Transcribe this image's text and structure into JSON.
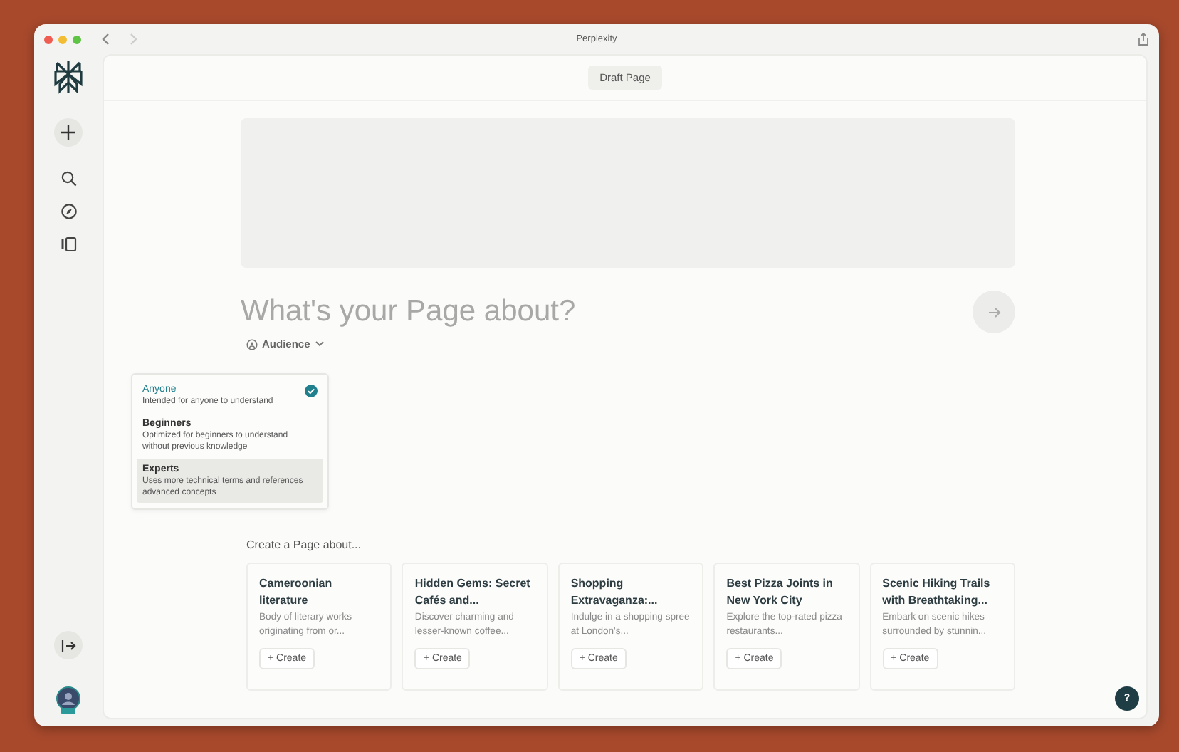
{
  "window": {
    "title": "Perplexity"
  },
  "header": {
    "button": "Draft Page"
  },
  "prompt": {
    "placeholder": "What's your Page about?"
  },
  "audience": {
    "label": "Audience",
    "options": [
      {
        "title": "Anyone",
        "description": "Intended for anyone to understand",
        "selected": true,
        "highlighted": false
      },
      {
        "title": "Beginners",
        "description": "Optimized for beginners to understand without previous knowledge",
        "selected": false,
        "highlighted": false
      },
      {
        "title": "Experts",
        "description": "Uses more technical terms and references advanced concepts",
        "selected": false,
        "highlighted": true
      }
    ]
  },
  "suggestions": {
    "title": "Create a Page about...",
    "cards": [
      {
        "title": "Cameroonian literature",
        "description": "Body of literary works originating from or...",
        "action": "+ Create"
      },
      {
        "title": "Hidden Gems: Secret Cafés and...",
        "description": "Discover charming and lesser-known coffee...",
        "action": "+ Create"
      },
      {
        "title": "Shopping Extravaganza:...",
        "description": "Indulge in a shopping spree at London's...",
        "action": "+ Create"
      },
      {
        "title": "Best Pizza Joints in New York City",
        "description": "Explore the top-rated pizza restaurants...",
        "action": "+ Create"
      },
      {
        "title": "Scenic Hiking Trails with Breathtaking...",
        "description": "Embark on scenic hikes surrounded by stunnin...",
        "action": "+ Create"
      }
    ]
  },
  "help": {
    "label": "?"
  }
}
